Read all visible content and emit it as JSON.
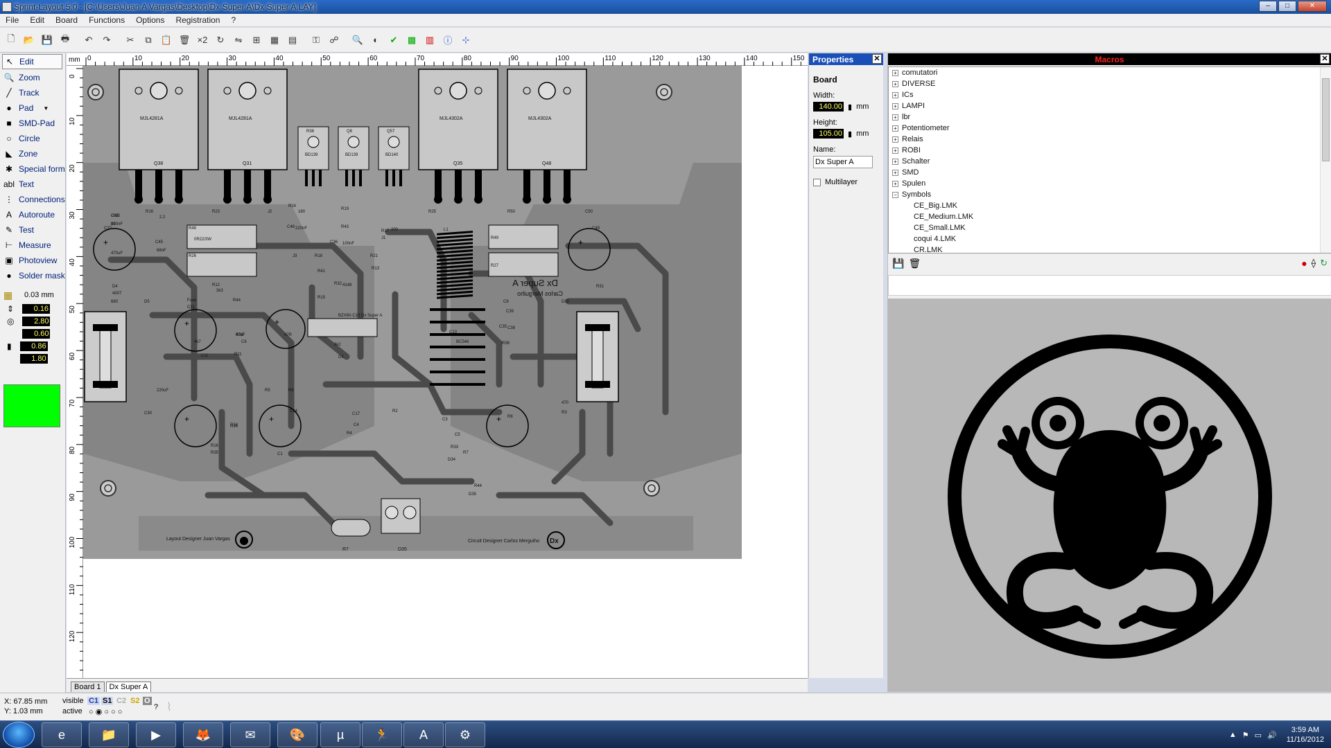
{
  "window": {
    "title": "Sprint-Layout 5.0 - [C:\\Users\\Juan A Vargas\\Desktop\\Dx Super A\\Dx Super A.LAY]",
    "min": "–",
    "max": "□",
    "close": "✕"
  },
  "menu": [
    "File",
    "Edit",
    "Board",
    "Functions",
    "Options",
    "Registration",
    "?"
  ],
  "toolbar": {
    "icons": [
      "new-file-icon",
      "open-folder-icon",
      "save-icon",
      "print-icon",
      "undo-icon",
      "redo-icon",
      "cut-icon",
      "copy-icon",
      "paste-icon",
      "delete-icon",
      "duplicate-icon",
      "rotate-icon",
      "mirror-icon",
      "align-icon",
      "group-icon",
      "ungroup-icon",
      "lock-icon",
      "unlock-icon",
      "zoom-icon",
      "ratsnest-icon",
      "drc-icon",
      "gerber-icon",
      "macro-icon",
      "info-icon",
      "snap-icon"
    ],
    "x2_label": "×2"
  },
  "tools": [
    {
      "name": "edit",
      "label": "Edit",
      "icon": "↖"
    },
    {
      "name": "zoom",
      "label": "Zoom",
      "icon": "🔍"
    },
    {
      "name": "track",
      "label": "Track",
      "icon": "╱"
    },
    {
      "name": "pad",
      "label": "Pad",
      "icon": "●"
    },
    {
      "name": "smd-pad",
      "label": "SMD-Pad",
      "icon": "■"
    },
    {
      "name": "circle",
      "label": "Circle",
      "icon": "○"
    },
    {
      "name": "zone",
      "label": "Zone",
      "icon": "◣"
    },
    {
      "name": "special-form",
      "label": "Special form",
      "icon": "✱"
    },
    {
      "name": "text",
      "label": "Text",
      "icon": "abl"
    },
    {
      "name": "connections",
      "label": "Connections",
      "icon": "⋮"
    },
    {
      "name": "autoroute",
      "label": "Autoroute",
      "icon": "A"
    },
    {
      "name": "test",
      "label": "Test",
      "icon": "✎"
    },
    {
      "name": "measure",
      "label": "Measure",
      "icon": "⊢"
    },
    {
      "name": "photoview",
      "label": "Photoview",
      "icon": "▣"
    },
    {
      "name": "solder-mask",
      "label": "Solder mask",
      "icon": "●"
    }
  ],
  "grid": {
    "value": "0.03 mm"
  },
  "params": {
    "track_width": "0.16",
    "pad_outer": "2.80",
    "pad_inner": "0.60",
    "smd_w": "0.86",
    "smd_h": "1.80"
  },
  "colors": {
    "active_layer": "#00ff00",
    "board": "#9a9a9a",
    "copper": "#4a4a4a"
  },
  "ruler": {
    "unit": "mm",
    "h_ticks": [
      "0",
      "10",
      "20",
      "30",
      "40",
      "50",
      "60",
      "70",
      "80",
      "90",
      "100",
      "110",
      "120",
      "130",
      "140",
      "150"
    ],
    "v_ticks": [
      "0",
      "10",
      "20",
      "30",
      "40",
      "50",
      "60",
      "70",
      "80",
      "90",
      "100",
      "110",
      "120"
    ]
  },
  "pcb": {
    "transistors": [
      "MJL4281A",
      "MJL4281A",
      "MJL4302A",
      "MJL4302A"
    ],
    "transistor_refs": [
      "Q38",
      "Q31",
      "Q35",
      "Q48"
    ],
    "small_transistors": [
      "BD139",
      "BD139",
      "BD140"
    ],
    "small_refs": [
      "R38",
      "Q8",
      "Q57"
    ],
    "title_mirror": "Dx Super A",
    "author_mirror": "Carlos Merguiho",
    "footer_left": "Layout Designer  Juan Vargas",
    "footer_right": "Circuit Designer  Carlos Merguiho",
    "logo": "Dx",
    "board_text": "BZX60-C10  Dx Super A",
    "labels": [
      "C39",
      "100nF",
      "R16",
      "2.2",
      "R23",
      "J2",
      "R24",
      "180",
      "R19",
      "R25",
      "R50",
      "C50",
      "C32",
      "470uF",
      "C45",
      "68nF",
      "R48",
      "0R22/3W",
      "R26",
      "C48",
      "220nF",
      "R43",
      "C36",
      "100nF",
      "J3",
      "J1",
      "R17",
      "200",
      "L1",
      "R49",
      "R27",
      "C49",
      "D4",
      "4007",
      "R12",
      "3k3",
      "R32",
      "4148",
      "R18",
      "R41",
      "R21",
      "R13",
      "R31",
      "680",
      "D5",
      "Fuse",
      "C31",
      "R44",
      "4k7",
      "R15",
      "C8",
      "D30",
      "C39",
      "C35",
      "C38",
      "R30",
      "47R",
      "C11",
      "47uF",
      "C6",
      "R11",
      "8k2",
      "D2",
      "C13",
      "BC546",
      "R36",
      "470",
      "R16",
      "R35",
      "C1",
      "C30",
      "220uF",
      "C17",
      "C4",
      "R34",
      "R14",
      "R4",
      "R5",
      "R6",
      "R8",
      "R3",
      "R2",
      "C3",
      "C34",
      "C5",
      "R33",
      "R44",
      "R7",
      "D35",
      "D34",
      "GND",
      "IN"
    ]
  },
  "tabs": [
    "Board 1",
    "Dx Super A"
  ],
  "properties": {
    "title": "Properties",
    "section": "Board",
    "width_label": "Width:",
    "width_value": "140.00",
    "height_label": "Height:",
    "height_value": "105.00",
    "unit": "mm",
    "name_label": "Name:",
    "name_value": "Dx Super A",
    "multilayer_label": "Multilayer"
  },
  "macros": {
    "title": "Macros",
    "folders": [
      "comutatori",
      "DIVERSE",
      "ICs",
      "LAMPI",
      "lbr",
      "Potentiometer",
      "Relais",
      "ROBI",
      "Schalter",
      "SMD",
      "Spulen",
      "Symbols"
    ],
    "symbols_children": [
      "CE_Big.LMK",
      "CE_Medium.LMK",
      "CE_Small.LMK",
      "coqui 4.LMK",
      "CR.LMK"
    ],
    "expand_open": "−",
    "expand_closed": "+"
  },
  "status": {
    "x": "X:  67.85 mm",
    "y": "Y:   1.03 mm",
    "visible_label": "visible",
    "active_label": "active",
    "layers": [
      "C1",
      "S1",
      "C2",
      "S2",
      "O"
    ],
    "help": "?"
  },
  "taskbar": {
    "apps": [
      "internet-explorer-icon",
      "explorer-folder-icon",
      "media-player-icon",
      "firefox-icon",
      "folder-mail-icon",
      "paint-icon",
      "utorrent-icon",
      "runner-icon",
      "acrobat-icon",
      "sprint-layout-icon"
    ],
    "time": "3:59 AM",
    "date": "11/16/2012"
  }
}
